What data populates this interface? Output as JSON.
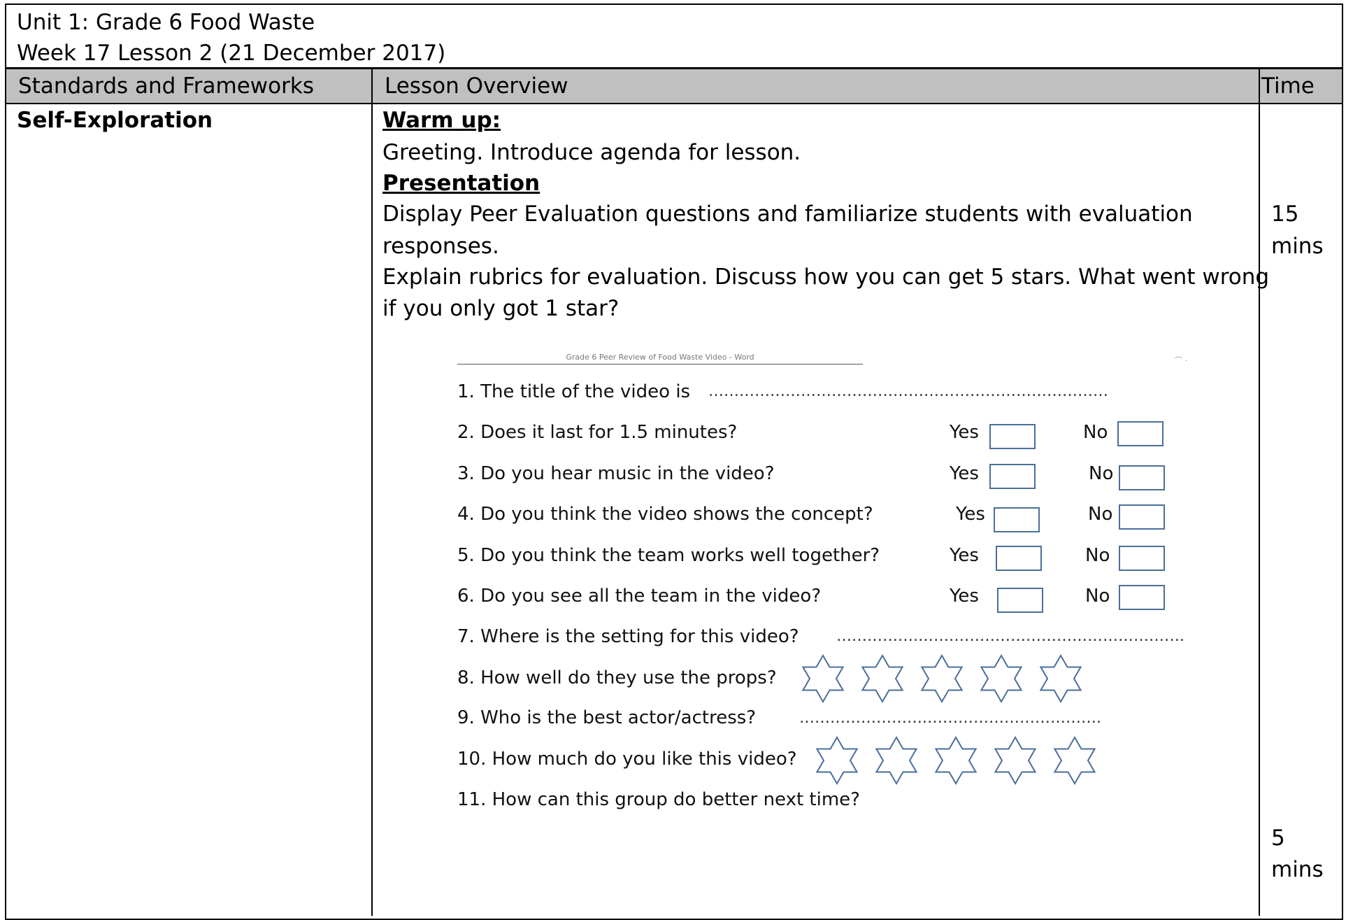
{
  "header": {
    "line1": "Unit 1: Grade 6 Food Waste",
    "line2": "Week 17 Lesson 2  (21 December 2017)"
  },
  "columns": {
    "standards": "Standards and Frameworks",
    "overview": "Lesson Overview",
    "time": "Time"
  },
  "standards": {
    "label": "Self-Exploration"
  },
  "overview": {
    "warmup_heading": "Warm up:",
    "warmup_text": "Greeting.  Introduce agenda for lesson.",
    "presentation_heading": "Presentation",
    "presentation_line1": "Display Peer Evaluation questions and familiarize students with evaluation",
    "presentation_line2": "responses.",
    "presentation_line3": "Explain rubrics for evaluation. Discuss how you can get 5 stars.  What went wrong",
    "presentation_line4": "if you only got 1 star?"
  },
  "form": {
    "caption": "Grade 6 Peer Review of Food Waste Video - Word",
    "q1": "1. The title of the video is",
    "q1_dots": "……………………………………………………………………",
    "q2": "2. Does it last for 1.5 minutes?",
    "q3": "3. Do you hear music in the video?",
    "q4": "4. Do you think the video shows the concept?",
    "q5": "5. Do you think the team works well together?",
    "q6": "6. Do you see all the team in the video?",
    "q7": "7. Where is the setting for this video?",
    "q7_dots": "…………….…………………………………………….",
    "q8": "8. How well do they use the props?",
    "q9": "9. Who is the best actor/actress?",
    "q9_dots": "…………………….…………………………….",
    "q10": "10. How much do you like this video?",
    "q11": "11. How can this group do better next time?",
    "yes": "Yes",
    "no": "No",
    "stars_q8": 5,
    "stars_q10": 5,
    "star_outline_color": "#4a6f9a",
    "box_outline_color": "#4a6f9a"
  },
  "time": {
    "t1_value": "15",
    "t1_unit": "mins",
    "t2_value": "5",
    "t2_unit": "mins"
  },
  "colors": {
    "header_fill": "#c0c0c0"
  }
}
